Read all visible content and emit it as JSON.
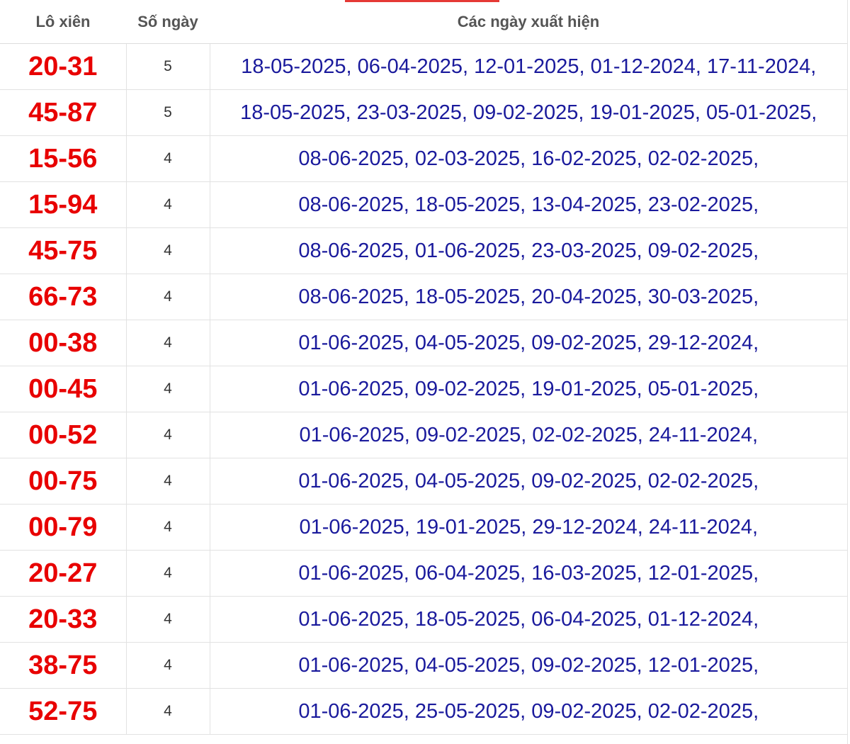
{
  "table": {
    "headers": {
      "pair": "Lô xiên",
      "count": "Số ngày",
      "dates": "Các ngày xuất hiện"
    },
    "rows": [
      {
        "pair": "20-31",
        "count": "5",
        "dates": "18-05-2025, 06-04-2025, 12-01-2025, 01-12-2024, 17-11-2024,"
      },
      {
        "pair": "45-87",
        "count": "5",
        "dates": "18-05-2025, 23-03-2025, 09-02-2025, 19-01-2025, 05-01-2025,"
      },
      {
        "pair": "15-56",
        "count": "4",
        "dates": "08-06-2025, 02-03-2025, 16-02-2025, 02-02-2025,"
      },
      {
        "pair": "15-94",
        "count": "4",
        "dates": "08-06-2025, 18-05-2025, 13-04-2025, 23-02-2025,"
      },
      {
        "pair": "45-75",
        "count": "4",
        "dates": "08-06-2025, 01-06-2025, 23-03-2025, 09-02-2025,"
      },
      {
        "pair": "66-73",
        "count": "4",
        "dates": "08-06-2025, 18-05-2025, 20-04-2025, 30-03-2025,"
      },
      {
        "pair": "00-38",
        "count": "4",
        "dates": "01-06-2025, 04-05-2025, 09-02-2025, 29-12-2024,"
      },
      {
        "pair": "00-45",
        "count": "4",
        "dates": "01-06-2025, 09-02-2025, 19-01-2025, 05-01-2025,"
      },
      {
        "pair": "00-52",
        "count": "4",
        "dates": "01-06-2025, 09-02-2025, 02-02-2025, 24-11-2024,"
      },
      {
        "pair": "00-75",
        "count": "4",
        "dates": "01-06-2025, 04-05-2025, 09-02-2025, 02-02-2025,"
      },
      {
        "pair": "00-79",
        "count": "4",
        "dates": "01-06-2025, 19-01-2025, 29-12-2024, 24-11-2024,"
      },
      {
        "pair": "20-27",
        "count": "4",
        "dates": "01-06-2025, 06-04-2025, 16-03-2025, 12-01-2025,"
      },
      {
        "pair": "20-33",
        "count": "4",
        "dates": "01-06-2025, 18-05-2025, 06-04-2025, 01-12-2024,"
      },
      {
        "pair": "38-75",
        "count": "4",
        "dates": "01-06-2025, 04-05-2025, 09-02-2025, 12-01-2025,"
      },
      {
        "pair": "52-75",
        "count": "4",
        "dates": "01-06-2025, 25-05-2025, 09-02-2025, 02-02-2025,"
      }
    ]
  },
  "colors": {
    "pair_text": "#e80000",
    "date_text": "#1a1a9c",
    "count_text": "#333333",
    "header_text": "#555555",
    "accent": "#e53935",
    "grid": "#e2e2e2"
  }
}
